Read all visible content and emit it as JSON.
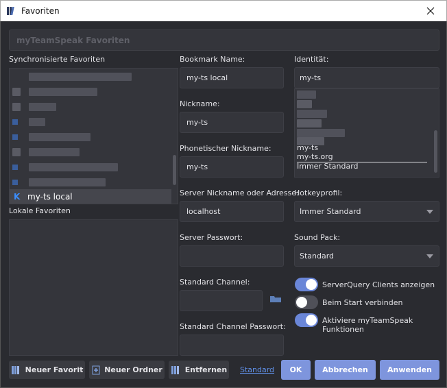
{
  "window": {
    "title": "Favoriten"
  },
  "header": {
    "text": "myTeamSpeak Favoriten"
  },
  "synced": {
    "label": "Synchronisierte Favoriten",
    "selected_item": "my-ts local"
  },
  "local": {
    "label": "Lokale Favoriten"
  },
  "form": {
    "bookmark_label": "Bookmark Name:",
    "bookmark_value": "my-ts local",
    "nickname_label": "Nickname:",
    "nickname_value": "my-ts",
    "phonetic_label": "Phonetischer Nickname:",
    "phonetic_value": "my-ts",
    "server_label": "Server Nickname oder Adresse:",
    "server_value": "localhost",
    "password_label": "Server Passwort:",
    "password_value": "",
    "channel_label": "Standard Channel:",
    "channel_value": "",
    "channel_pw_label": "Standard Channel Passwort:",
    "channel_pw_value": ""
  },
  "identity": {
    "label": "Identität:",
    "value": "my-ts",
    "options": [
      "my-ts",
      "my-ts.org",
      "Immer Standard"
    ]
  },
  "hotkey": {
    "label": "Hotkeyprofil:",
    "value": "Immer Standard"
  },
  "soundpack": {
    "label": "Sound Pack:",
    "value": "Standard"
  },
  "toggles": [
    {
      "label": "ServerQuery Clients anzeigen",
      "on": true
    },
    {
      "label": "Beim Start verbinden",
      "on": false
    },
    {
      "label": "Aktiviere myTeamSpeak Funktionen",
      "on": true
    }
  ],
  "buttons": {
    "new_favorite": "Neuer Favorit",
    "new_folder": "Neuer Ordner",
    "remove": "Entfernen",
    "standard_link": "Standard",
    "ok": "OK",
    "cancel": "Abbrechen",
    "apply": "Anwenden"
  },
  "colors": {
    "accent": "#7e95dd",
    "link": "#5f8fe6",
    "background": "#2a2b30"
  }
}
